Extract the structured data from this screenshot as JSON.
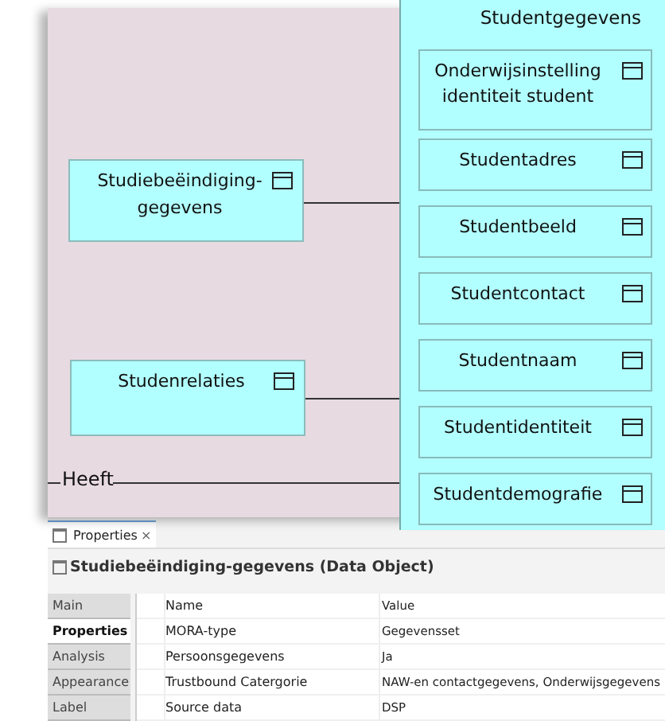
{
  "diagram": {
    "group": {
      "label": "Studentgegevens",
      "children": [
        {
          "label": "Onderwijsinstelling identiteit student"
        },
        {
          "label": "Studentadres"
        },
        {
          "label": "Studentbeeld"
        },
        {
          "label": "Studentcontact"
        },
        {
          "label": "Studentnaam"
        },
        {
          "label": "Studentidentiteit"
        },
        {
          "label": "Studentdemografie"
        }
      ]
    },
    "nodes": [
      {
        "label": "Studiebeëindiging-gegevens"
      },
      {
        "label": "Studenrelaties"
      }
    ],
    "connection_label": "Heeft"
  },
  "properties": {
    "tab": {
      "label": "Properties",
      "close": "×"
    },
    "title": "Studiebeëindiging-gegevens (Data Object)",
    "side_tabs": [
      {
        "label": "Main",
        "selected": false
      },
      {
        "label": "Properties",
        "selected": true
      },
      {
        "label": "Analysis",
        "selected": false
      },
      {
        "label": "Appearance",
        "selected": false
      },
      {
        "label": "Label",
        "selected": false
      }
    ],
    "table": {
      "columns": [
        "Name",
        "Value"
      ],
      "rows": [
        [
          "MORA-type",
          "Gegevensset"
        ],
        [
          "Persoonsgegevens",
          "Ja"
        ],
        [
          "Trustbound Catergorie",
          "NAW-en contactgegevens, Onderwijsgegevens"
        ],
        [
          "Source data",
          "DSP"
        ]
      ]
    }
  }
}
